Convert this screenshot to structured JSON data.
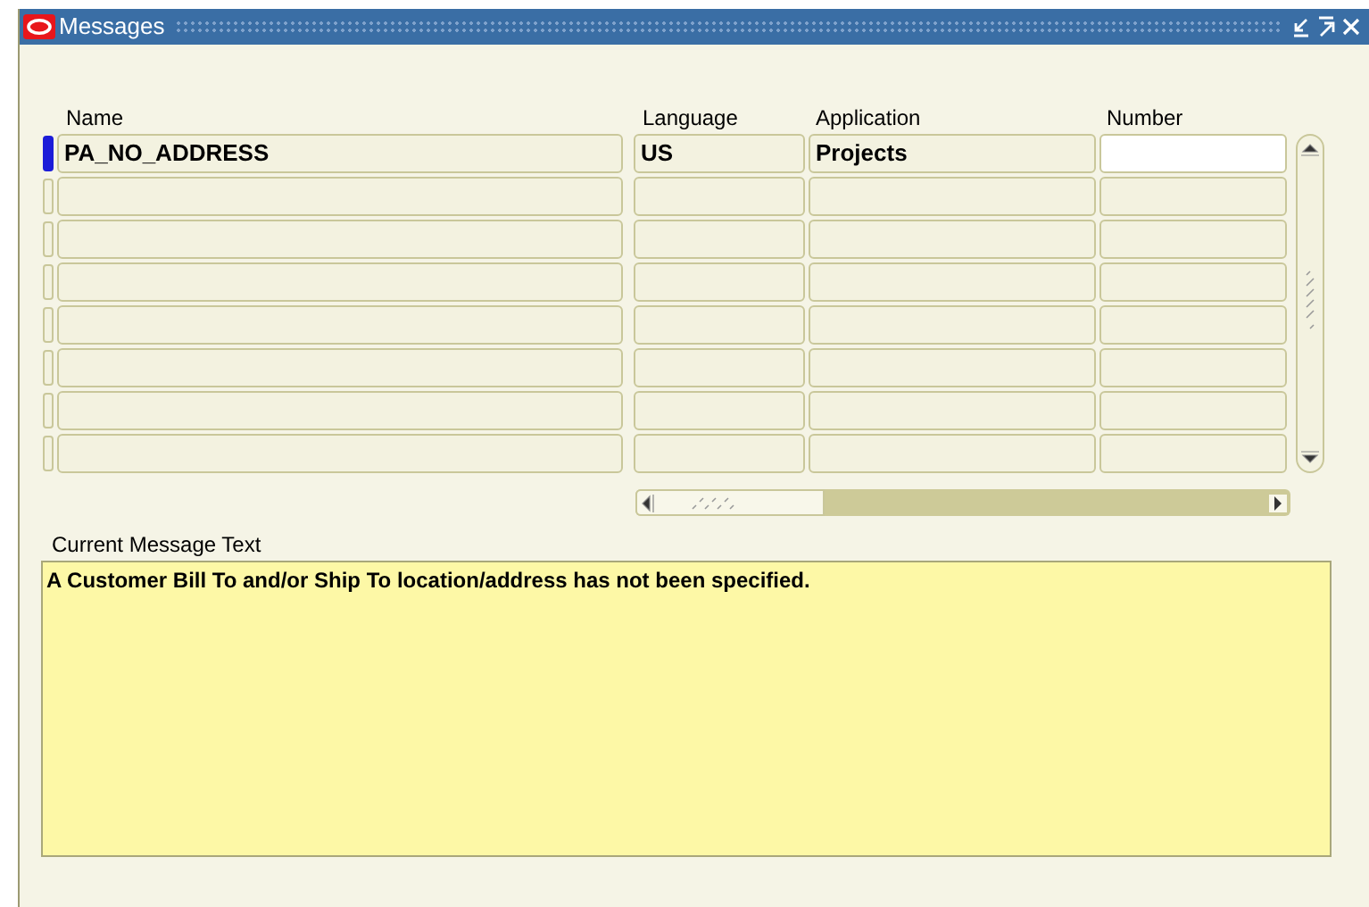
{
  "window": {
    "title": "Messages"
  },
  "table": {
    "columns": [
      "Name",
      "Language",
      "Application",
      "Number"
    ],
    "rows": [
      {
        "selected": true,
        "name": "PA_NO_ADDRESS",
        "language": "US",
        "application": "Projects"
      },
      {
        "selected": false
      },
      {
        "selected": false
      },
      {
        "selected": false
      },
      {
        "selected": false
      },
      {
        "selected": false
      },
      {
        "selected": false
      },
      {
        "selected": false
      }
    ]
  },
  "message": {
    "label": "Current Message Text",
    "text": "A Customer Bill To and/or Ship To location/address has not been specified."
  }
}
